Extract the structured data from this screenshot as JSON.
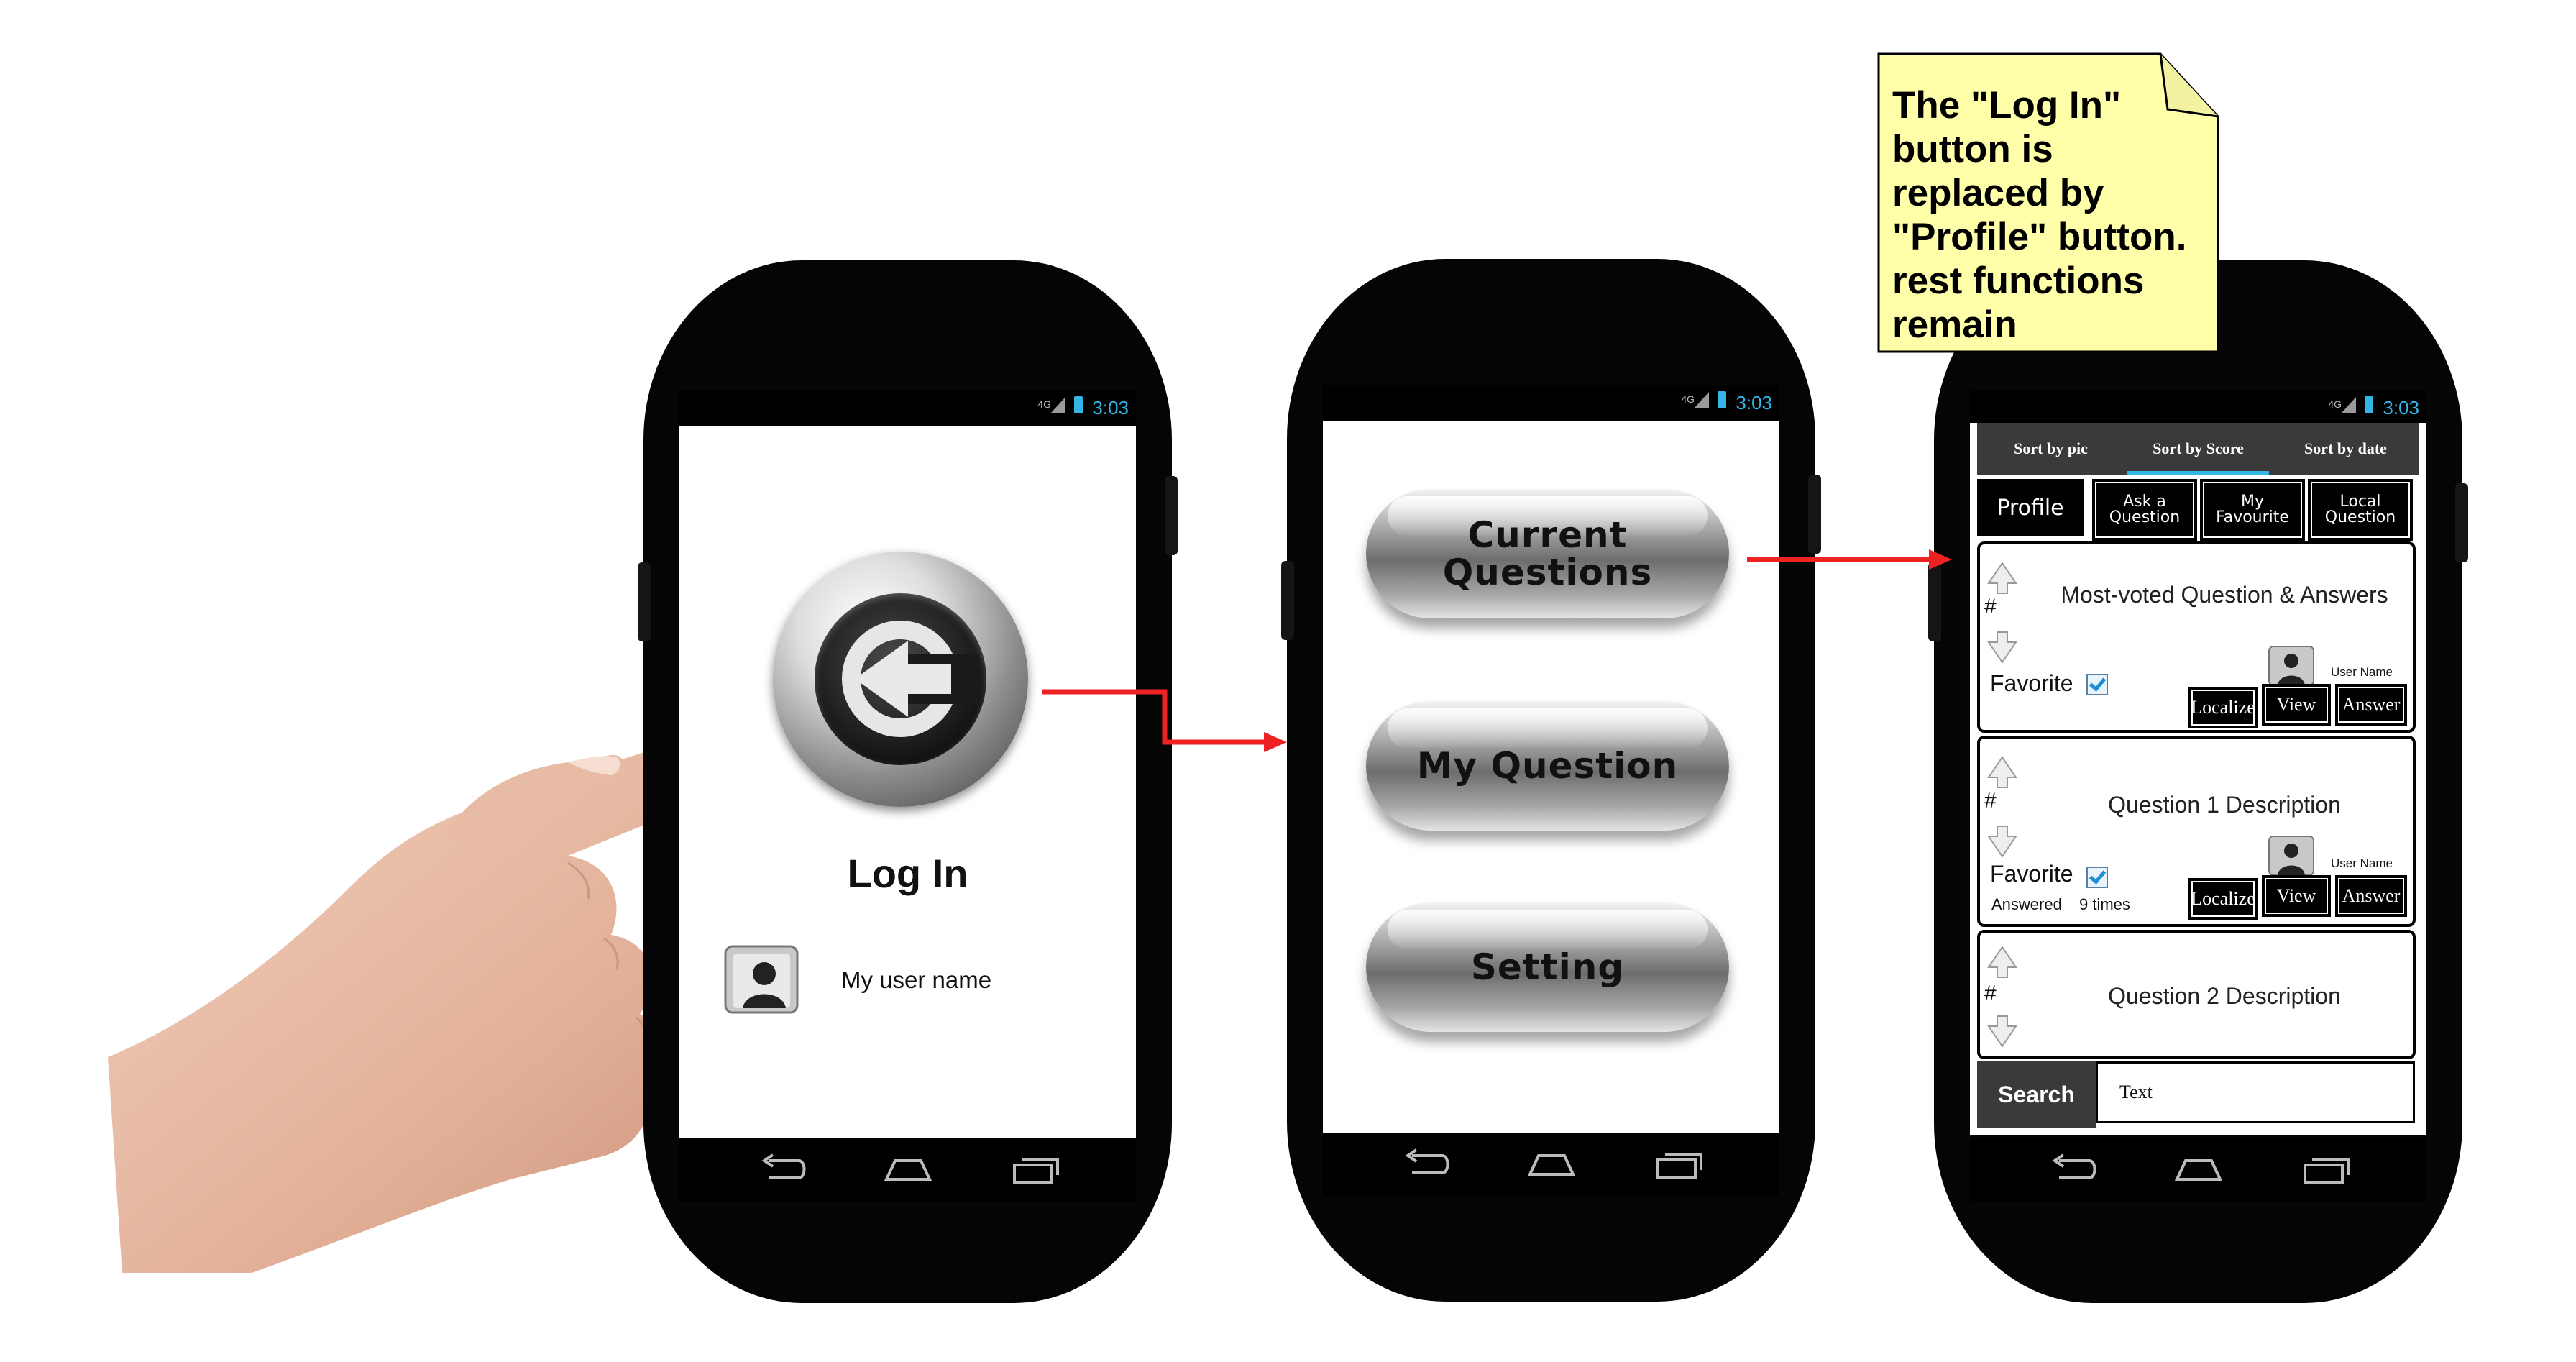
{
  "status_bar": {
    "network": "4G",
    "time": "3:03"
  },
  "phone1": {
    "login_label": "Log In",
    "user_name": "My user name",
    "icons": {
      "login": "login-arrow-icon",
      "avatar": "user-avatar-icon"
    }
  },
  "phone2": {
    "buttons": [
      "Current\nQuestions",
      "My Question",
      "Setting"
    ]
  },
  "phone3": {
    "sort_tabs": [
      "Sort by pic",
      "Sort by Score",
      "Sort by date"
    ],
    "active_sort": "Sort by Score",
    "actions": {
      "profile": "Profile",
      "ask": "Ask a\nQuestion",
      "favourite": "My\nFavourite",
      "local": "Local\nQuestion"
    },
    "questions": [
      {
        "hash": "#",
        "title": "Most-voted Question & Answers",
        "favorite_label": "Favorite",
        "favorite_checked": true,
        "user_name": "User Name",
        "buttons": [
          "Localize",
          "View",
          "Answer"
        ]
      },
      {
        "hash": "#",
        "title": "Question 1 Description",
        "favorite_label": "Favorite",
        "favorite_checked": true,
        "answered_label": "Answered",
        "answered_count": "9 times",
        "user_name": "User Name",
        "buttons": [
          "Localize",
          "View",
          "Answer"
        ]
      },
      {
        "hash": "#",
        "title": "Question 2 Description"
      }
    ],
    "search": {
      "button": "Search",
      "value": "Text"
    }
  },
  "note": {
    "text": "The \"Log In\" button is replaced by \"Profile\" button. rest functions remain"
  },
  "colors": {
    "accent": "#33b5e5",
    "arrow": "#ee2222",
    "note_bg": "#ffffaa",
    "phone_body": "#050505",
    "tab_bar": "#3a3a3a"
  }
}
